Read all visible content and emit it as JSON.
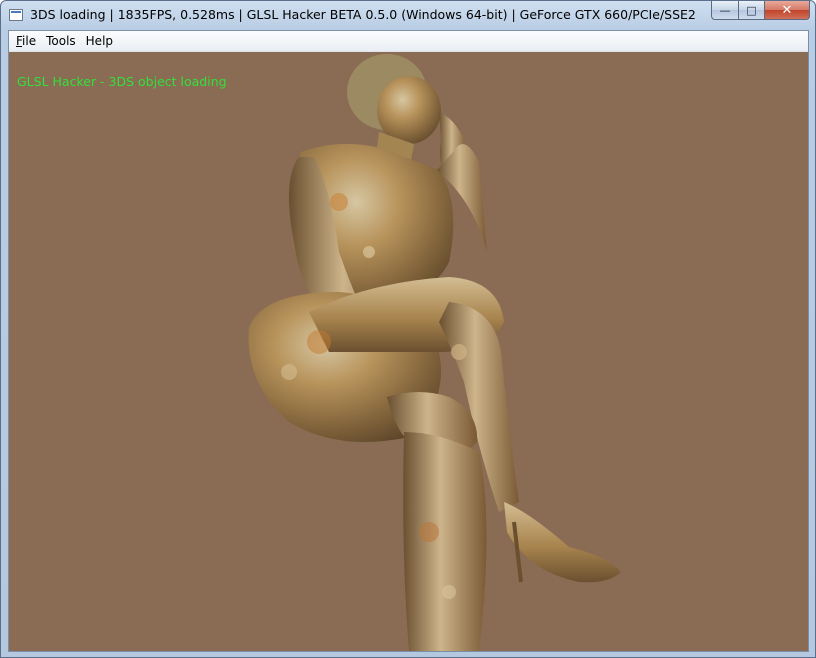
{
  "window": {
    "title": "3DS loading | 1835FPS, 0.528ms | GLSL Hacker BETA 0.5.0 (Windows 64-bit) | GeForce GTX 660/PCIe/SSE2",
    "minimize_glyph": "—",
    "maximize_glyph": "□",
    "close_glyph": "✕"
  },
  "menu": {
    "items": [
      {
        "prefix": "",
        "accel": "F",
        "rest": "ile"
      },
      {
        "prefix": "",
        "accel": "",
        "rest": "Tools"
      },
      {
        "prefix": "",
        "accel": "",
        "rest": "Help"
      }
    ]
  },
  "viewport": {
    "overlay_text": "GLSL Hacker - 3DS object loading",
    "overlay_color": "#33e03a",
    "background_color": "#8a6c54",
    "model": "seated-woman-statue-marble-texture"
  }
}
